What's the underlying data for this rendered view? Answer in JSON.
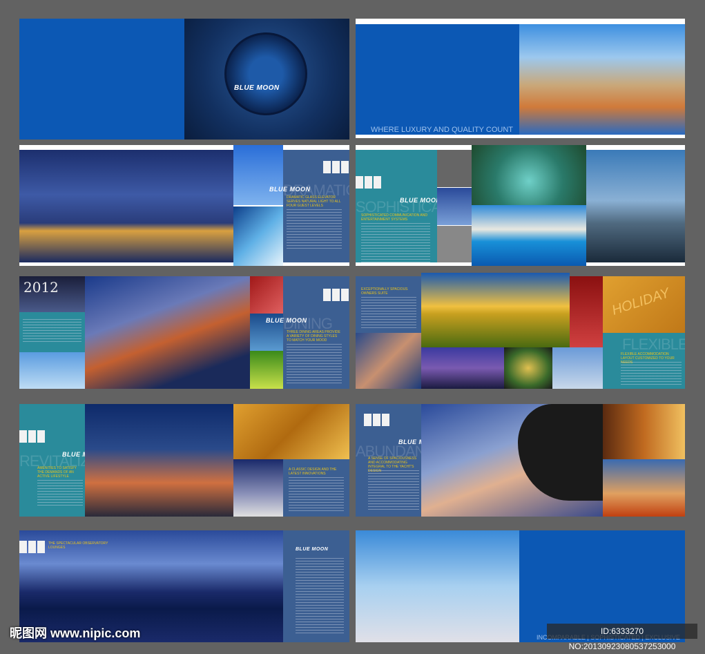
{
  "brand": "BLUE MOON",
  "spreads": {
    "cover": {
      "tagline": "WHERE LUXURY AND QUALITY COUNT"
    },
    "dramatic": {
      "ghost": "DRAMATIC",
      "heading": "DRAMATIC GLASS ELEVATOR SERVES NATURAL LIGHT TO ALL FOUR GUEST LEVELS"
    },
    "sophisticated": {
      "ghost": "SOPHISTICATED",
      "heading": "SOPHISTICATED COMMUNICATION AND ENTERTAINMENT SYSTEMS"
    },
    "dining": {
      "ghost": "DINING",
      "heading": "THREE DINING AREAS PROVIDE A VARIETY OF DINING STYLES TO MATCH YOUR MOOD",
      "photo_text": "2012"
    },
    "suite": {
      "heading": "EXCEPTIONALLY SPACIOUS OWNERS SUITE"
    },
    "flexible": {
      "ghost": "FLEXIBLE",
      "heading": "FLEXIBLE ACCOMMODATION LAYOUT CUSTOMIZED TO YOUR NEEDS",
      "photo_text": "HOLIDAY"
    },
    "revitalize": {
      "ghost": "REVITALIZE",
      "heading": "AMENITIES TO SATISFY THE DEMANDS OF AN ACTIVE LIFESTYLE",
      "heading2": "A CLASSIC DESIGN AND THE LATEST INNOVATIONS"
    },
    "abundant": {
      "ghost": "ABUNDANT",
      "heading": "A SENSE OF SPACIOUSNESS AND ACCOMMODATING INTEGRAL TO THE YACHT'S DESIGN"
    },
    "observatory": {
      "heading": "THE SPECTACULAR OBSERVATORY LOUNGES"
    },
    "back": {
      "tagline": "INCOMPARABLE | SOPHISTICATED | EXCLUSIVE"
    }
  },
  "watermark": {
    "site": "昵图网 www.nipic.com",
    "id": "ID:6333270 NO:20130923080537253000"
  },
  "colors": {
    "blue": "#0c58b4",
    "panel": "#3c5f92",
    "teal": "#2a8b9b",
    "accent": "#e8c21d"
  }
}
